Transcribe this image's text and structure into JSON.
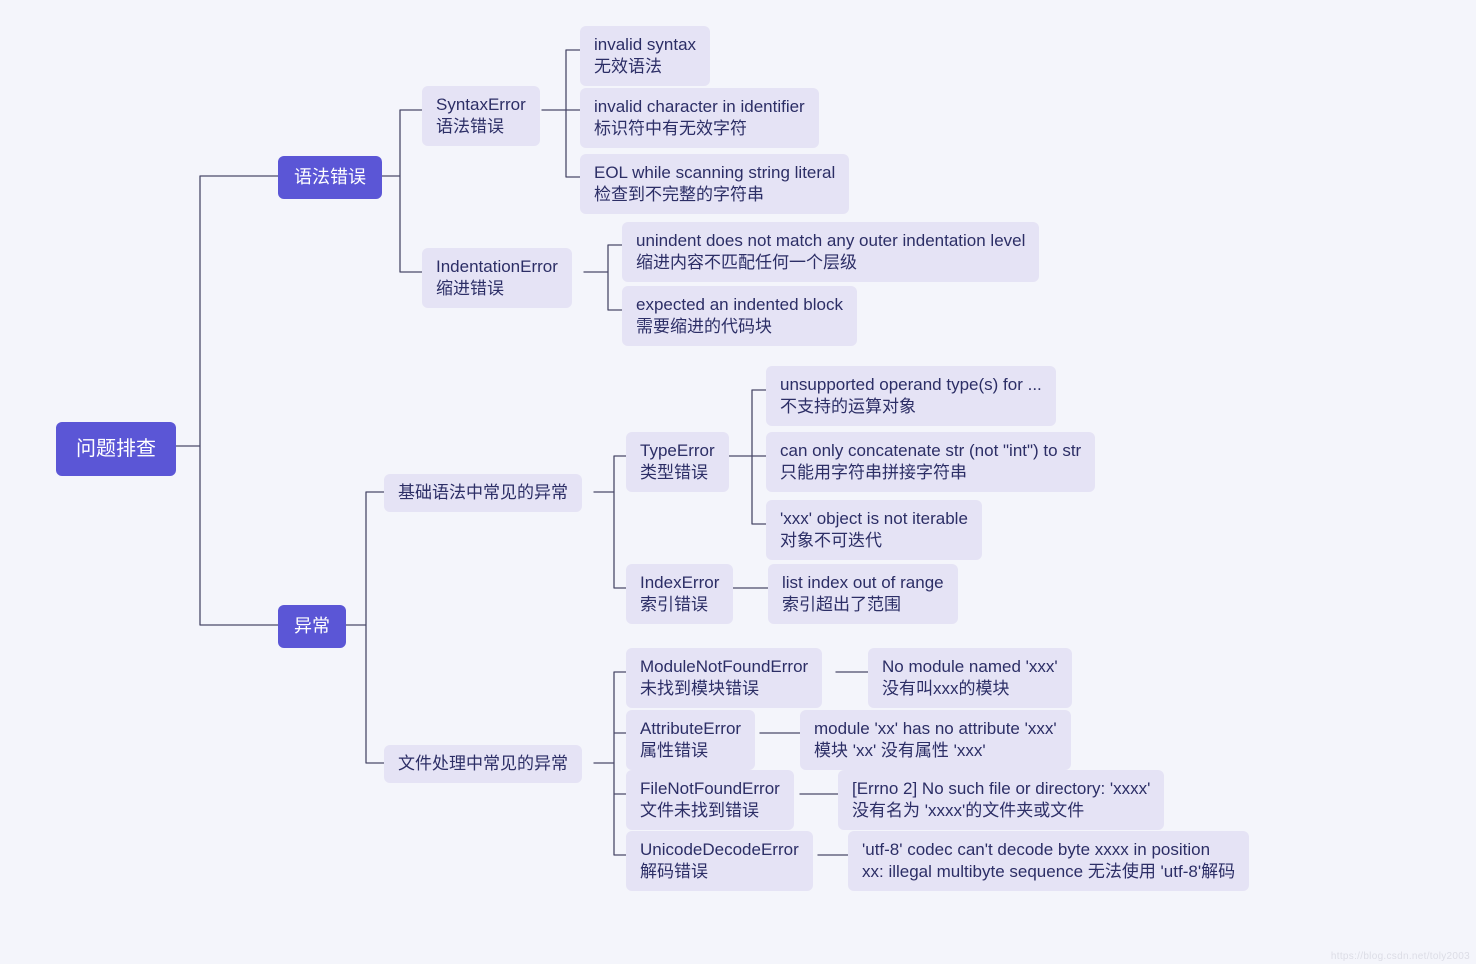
{
  "root": {
    "label": "问题排查"
  },
  "cats": {
    "syntax": {
      "label": "语法错误"
    },
    "exception": {
      "label": "异常"
    }
  },
  "boxes": {
    "se": {
      "l1": "SyntaxError",
      "l2": "语法错误"
    },
    "ie": {
      "l1": "IndentationError",
      "l2": "缩进错误"
    },
    "se1": {
      "l1": "invalid syntax",
      "l2": "无效语法"
    },
    "se2": {
      "l1": "invalid character in identifier",
      "l2": "标识符中有无效字符"
    },
    "se3": {
      "l1": "EOL while scanning string literal",
      "l2": "检查到不完整的字符串"
    },
    "ie1": {
      "l1": "unindent does not match any outer indentation level",
      "l2": "缩进内容不匹配任何一个层级"
    },
    "ie2": {
      "l1": "expected an indented block",
      "l2": "需要缩进的代码块"
    },
    "exA": {
      "l1": "基础语法中常见的异常"
    },
    "exB": {
      "l1": "文件处理中常见的异常"
    },
    "te": {
      "l1": "TypeError",
      "l2": "类型错误"
    },
    "xe": {
      "l1": "IndexError",
      "l2": "索引错误"
    },
    "te1": {
      "l1": "unsupported operand type(s) for ...",
      "l2": "不支持的运算对象"
    },
    "te2": {
      "l1": "can only concatenate str (not \"int\") to str",
      "l2": "只能用字符串拼接字符串"
    },
    "te3": {
      "l1": "'xxx' object is not iterable",
      "l2": "对象不可迭代"
    },
    "xe1": {
      "l1": "list index out of range",
      "l2": "索引超出了范围"
    },
    "mn": {
      "l1": "ModuleNotFoundError",
      "l2": "未找到模块错误"
    },
    "ae": {
      "l1": "AttributeError",
      "l2": "属性错误"
    },
    "fn": {
      "l1": "FileNotFoundError",
      "l2": "文件未找到错误"
    },
    "ud": {
      "l1": "UnicodeDecodeError",
      "l2": "解码错误"
    },
    "mn1": {
      "l1": "No module named 'xxx'",
      "l2": "没有叫xxx的模块"
    },
    "ae1": {
      "l1": "module 'xx' has no attribute 'xxx'",
      "l2": "模块 'xx' 没有属性 'xxx'"
    },
    "fn1": {
      "l1": "[Errno 2] No such file or directory: 'xxxx'",
      "l2": "没有名为 'xxxx'的文件夹或文件"
    },
    "ud1": {
      "l1": "'utf-8' codec can't decode byte xxxx in position",
      "l2": "xx: illegal multibyte sequence 无法使用 'utf-8'解码"
    }
  },
  "watermark": "https://blog.csdn.net/toly2003"
}
